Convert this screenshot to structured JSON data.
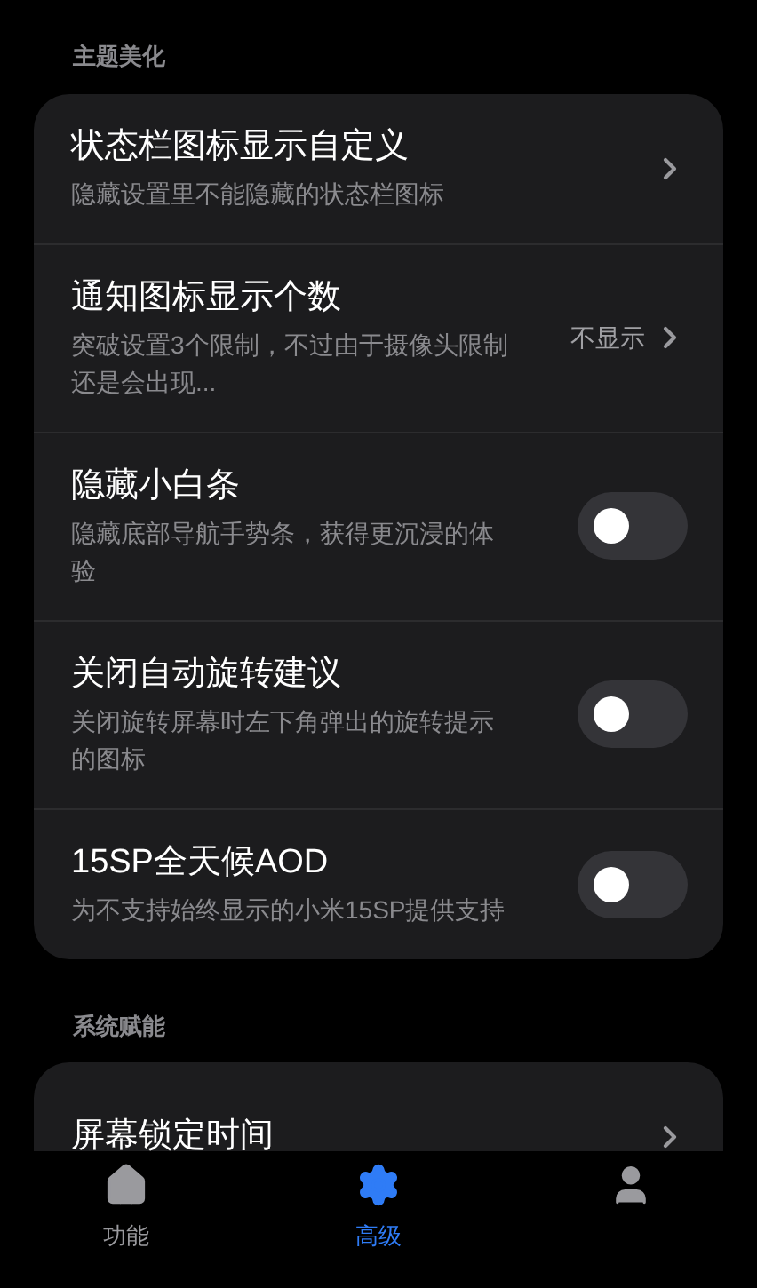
{
  "sections": [
    {
      "title": "主题美化",
      "items": [
        {
          "kind": "link",
          "title": "状态栏图标显示自定义",
          "subtitle": "隐藏设置里不能隐藏的状态栏图标"
        },
        {
          "kind": "link",
          "title": "通知图标显示个数",
          "subtitle": "突破设置3个限制，不过由于摄像头限制还是会出现...",
          "value": "不显示"
        },
        {
          "kind": "switch",
          "title": "隐藏小白条",
          "subtitle": "隐藏底部导航手势条，获得更沉浸的体验",
          "on": false
        },
        {
          "kind": "switch",
          "title": "关闭自动旋转建议",
          "subtitle": "关闭旋转屏幕时左下角弹出的旋转提示的图标",
          "on": false
        },
        {
          "kind": "switch",
          "title": "15SP全天候AOD",
          "subtitle": "为不支持始终显示的小米15SP提供支持",
          "on": false
        }
      ]
    },
    {
      "title": "系统赋能",
      "items": [
        {
          "kind": "link",
          "title": "屏幕锁定时间"
        }
      ]
    }
  ],
  "nav": [
    {
      "label": "功能",
      "selected": false
    },
    {
      "label": "高级",
      "selected": true
    },
    {
      "selected": false
    }
  ]
}
